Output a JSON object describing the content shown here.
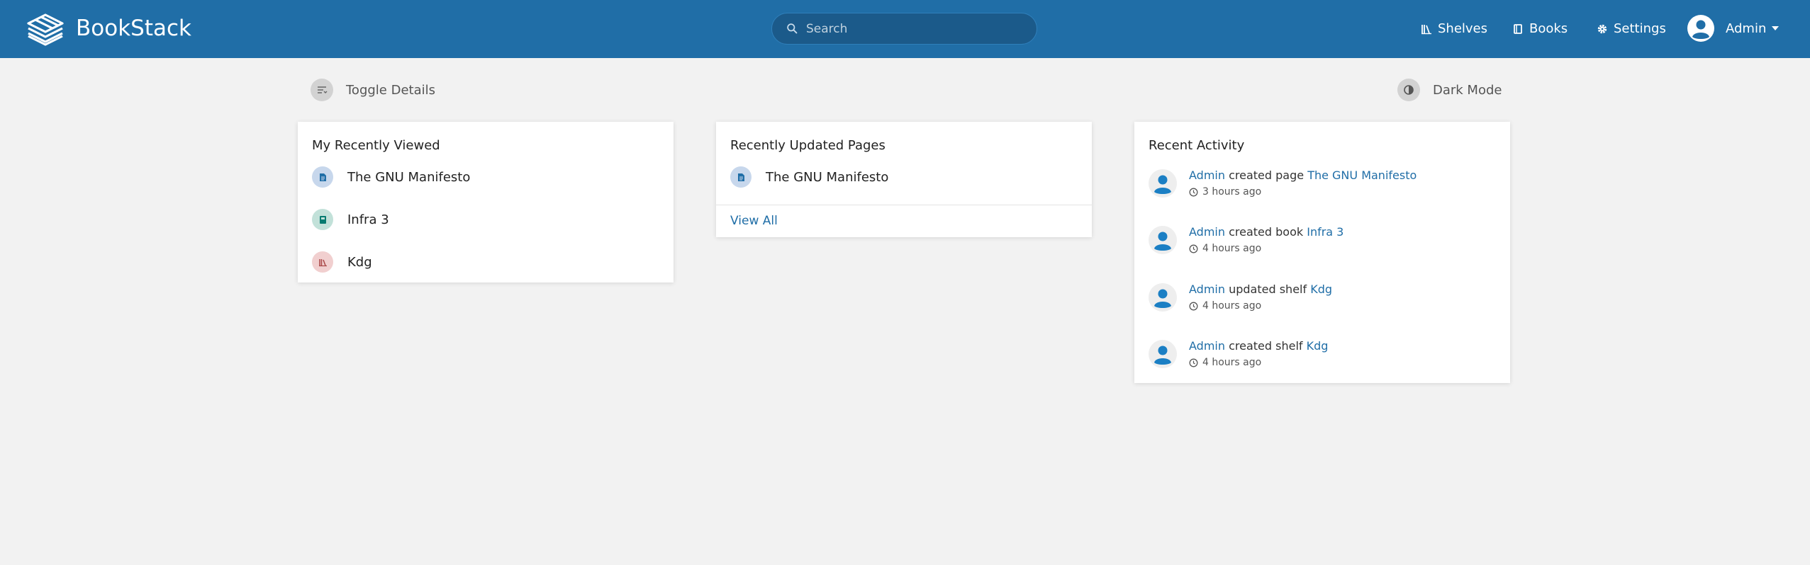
{
  "app": {
    "name": "BookStack"
  },
  "header": {
    "search_placeholder": "Search",
    "nav": [
      {
        "label": "Shelves",
        "icon": "shelves-icon"
      },
      {
        "label": "Books",
        "icon": "books-icon"
      },
      {
        "label": "Settings",
        "icon": "gear-icon"
      }
    ],
    "user": {
      "name": "Admin"
    }
  },
  "toolbar": {
    "toggle_details": "Toggle Details",
    "dark_mode": "Dark Mode"
  },
  "recently_viewed": {
    "title": "My Recently Viewed",
    "items": [
      {
        "label": "The GNU Manifesto",
        "type": "page"
      },
      {
        "label": "Infra 3",
        "type": "book"
      },
      {
        "label": "Kdg",
        "type": "shelf"
      }
    ]
  },
  "recently_updated": {
    "title": "Recently Updated Pages",
    "items": [
      {
        "label": "The GNU Manifesto",
        "type": "page"
      }
    ],
    "view_all": "View All"
  },
  "recent_activity": {
    "title": "Recent Activity",
    "items": [
      {
        "user": "Admin",
        "action": "created page",
        "target": "The GNU Manifesto",
        "time": "3 hours ago"
      },
      {
        "user": "Admin",
        "action": "created book",
        "target": "Infra 3",
        "time": "4 hours ago"
      },
      {
        "user": "Admin",
        "action": "updated shelf",
        "target": "Kdg",
        "time": "4 hours ago"
      },
      {
        "user": "Admin",
        "action": "created shelf",
        "target": "Kdg",
        "time": "4 hours ago"
      }
    ]
  },
  "colors": {
    "header": "#206ea7",
    "link": "#206ea7",
    "background": "#f2f2f2",
    "page": "#206ea7",
    "book": "#077b70",
    "shelf": "#a94747"
  }
}
